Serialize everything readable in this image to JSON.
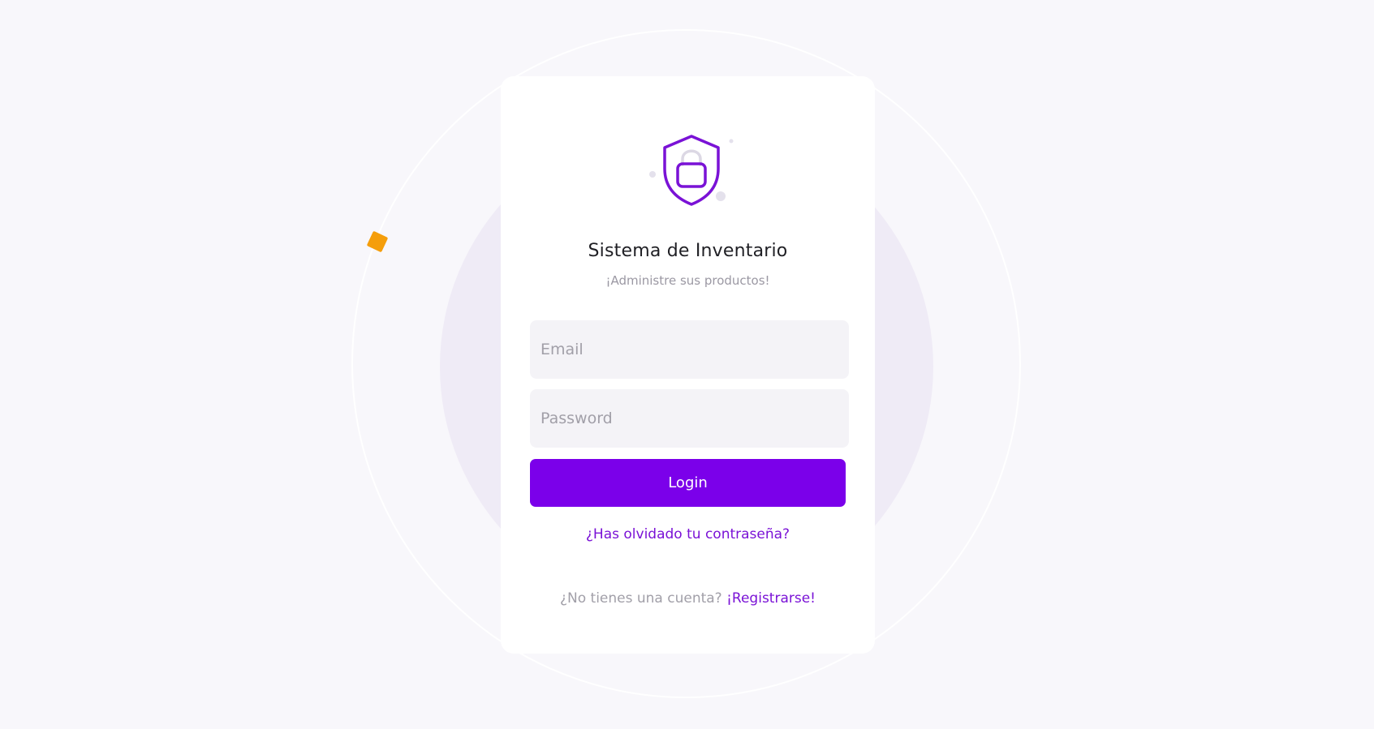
{
  "login": {
    "title": "Sistema de Inventario",
    "subtitle": "¡Administre sus productos!",
    "email_placeholder": "Email",
    "password_placeholder": "Password",
    "login_label": "Login",
    "forgot_label": "¿Has olvidado tu contraseña?",
    "signup_prompt": "¿No tienes una cuenta?",
    "signup_link": "¡Registrarse!"
  },
  "icons": {
    "logo": "shield-lock-icon"
  },
  "colors": {
    "accent": "#7b00ea",
    "link": "#7a12d6",
    "decor_diamond": "#f59e0b",
    "background": "#f8f7fb",
    "input_background": "#f4f3f7"
  }
}
